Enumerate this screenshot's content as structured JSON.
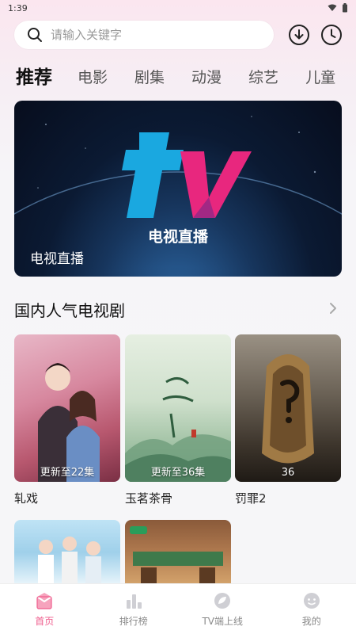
{
  "status_bar": {
    "time": "1:39"
  },
  "search": {
    "placeholder": "请输入关键字"
  },
  "tabs": [
    {
      "label": "推荐",
      "active": true
    },
    {
      "label": "电影",
      "active": false
    },
    {
      "label": "剧集",
      "active": false
    },
    {
      "label": "动漫",
      "active": false
    },
    {
      "label": "综艺",
      "active": false
    },
    {
      "label": "儿童",
      "active": false
    }
  ],
  "banner": {
    "logo_text": "电视直播",
    "caption": "电视直播"
  },
  "section": {
    "title": "国内人气电视剧",
    "items": [
      {
        "title": "轧戏",
        "badge": "更新至22集"
      },
      {
        "title": "玉茗茶骨",
        "badge": "更新至36集"
      },
      {
        "title": "罚罪2",
        "badge": "36"
      }
    ]
  },
  "bottom_nav": [
    {
      "label": "首页",
      "icon": "home-icon",
      "active": true
    },
    {
      "label": "排行榜",
      "icon": "bar-chart-icon",
      "active": false
    },
    {
      "label": "TV端上线",
      "icon": "tv-leaf-icon",
      "active": false
    },
    {
      "label": "我的",
      "icon": "smiley-icon",
      "active": false
    }
  ],
  "colors": {
    "accent": "#ef5d8d",
    "tv_cyan": "#1aa8e0",
    "tv_pink": "#e8277e"
  }
}
